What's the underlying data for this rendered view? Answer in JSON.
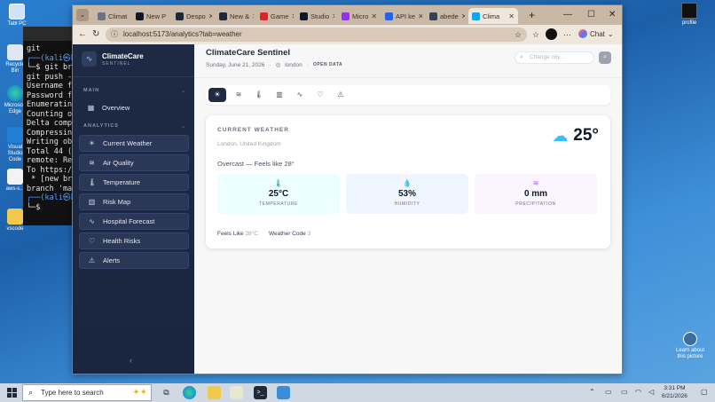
{
  "desktop": {
    "left_icons": [
      {
        "label": "Tabl PC"
      },
      {
        "label": "Recycle Bin"
      },
      {
        "label": "Microsoft Edge"
      },
      {
        "label": "Visual Studio Code"
      },
      {
        "label": "aws-s..."
      },
      {
        "label": "vscode"
      }
    ],
    "right_profile_label": "profile",
    "right_bottom_label": "Learn about this picture"
  },
  "terminal": {
    "lines": [
      "git",
      "┌──(kali㉿k",
      "└─$ git br",
      "git push -",
      "Username f",
      "Password f",
      "Enumeratin",
      "Counting o",
      "Delta comp",
      "Compressin",
      "Writing ob",
      "Total 44 (",
      "remote: Re",
      "To https:/",
      " * [new br",
      "branch 'ma",
      "",
      "┌──(kali㉿k",
      "└─$ "
    ]
  },
  "browser": {
    "tabs": [
      {
        "label": "Climat",
        "color": "#6b7280"
      },
      {
        "label": "New P",
        "color": "#111827"
      },
      {
        "label": "Despo",
        "color": "#1f2937"
      },
      {
        "label": "New &",
        "color": "#1f2937"
      },
      {
        "label": "Game",
        "color": "#dc2626"
      },
      {
        "label": "Studio",
        "color": "#111827"
      },
      {
        "label": "Micro",
        "color": "#9333ea"
      },
      {
        "label": "API ke",
        "color": "#2563eb"
      },
      {
        "label": "abede",
        "color": "#374151"
      },
      {
        "label": "Clima",
        "color": "#0ea5e9"
      }
    ],
    "url": "localhost:5173/analytics?tab=weather",
    "chat_label": "Chat"
  },
  "sidebar": {
    "brand_title": "ClimateCare",
    "brand_sub": "SENTINEL",
    "main_label": "MAIN",
    "analytics_label": "ANALYTICS",
    "overview": {
      "label": "Overview",
      "icon": "grid-icon"
    },
    "items": [
      {
        "label": "Current Weather",
        "icon": "sun-icon"
      },
      {
        "label": "Air Quality",
        "icon": "wind-icon"
      },
      {
        "label": "Temperature",
        "icon": "thermometer-icon"
      },
      {
        "label": "Risk Map",
        "icon": "map-icon"
      },
      {
        "label": "Hospital Forecast",
        "icon": "activity-icon"
      },
      {
        "label": "Health Risks",
        "icon": "heart-icon"
      },
      {
        "label": "Alerts",
        "icon": "alert-icon"
      }
    ]
  },
  "header": {
    "title": "ClimateCare Sentinel",
    "date": "Sunday, June 21, 2026",
    "location": "london",
    "badge": "OPEN DATA",
    "search_placeholder": "Change city..."
  },
  "weather": {
    "label": "CURRENT WEATHER",
    "location": "London, United Kingdom",
    "temperature": "25°",
    "description": "Overcast — Feels like 28°",
    "stats": [
      {
        "value": "25°C",
        "label": "TEMPERATURE",
        "bg": "#ecfeff",
        "icon_color": "#0891b2"
      },
      {
        "value": "53%",
        "label": "HUMIDITY",
        "bg": "#eff6ff",
        "icon_color": "#3b82f6"
      },
      {
        "value": "0 mm",
        "label": "PRECIPITATION",
        "bg": "#faf5ff",
        "icon_color": "#a855f7"
      }
    ],
    "feels_like_label": "Feels Like",
    "feels_like_value": "28°C",
    "weather_code_label": "Weather Code",
    "weather_code_value": "3"
  },
  "taskbar": {
    "search_placeholder": "Type here to search",
    "time": "3:31 PM",
    "date": "6/21/2026"
  }
}
